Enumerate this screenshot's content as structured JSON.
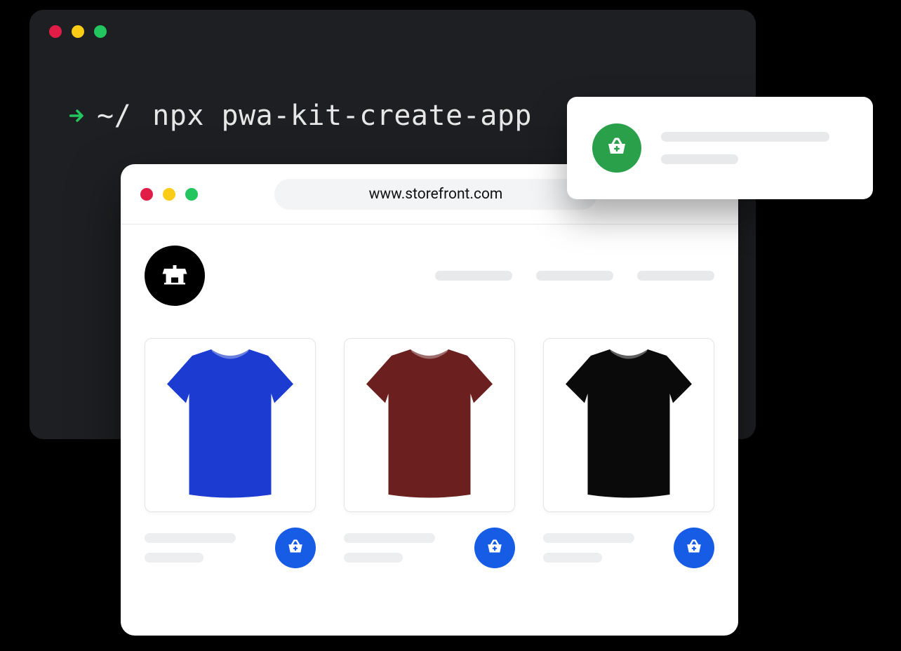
{
  "terminal": {
    "prompt": "~/",
    "command": "npx pwa-kit-create-app"
  },
  "notification": {
    "icon": "basket-plus-icon",
    "badge_color": "#2aa04a"
  },
  "browser": {
    "url": "www.storefront.com"
  },
  "store": {
    "logo_icon": "storefront-icon",
    "products": [
      {
        "icon": "tshirt",
        "color": "#1c3bd1",
        "name": "blue-tshirt"
      },
      {
        "icon": "tshirt",
        "color": "#6b1f1f",
        "name": "maroon-tshirt"
      },
      {
        "icon": "tshirt",
        "color": "#0a0a0a",
        "name": "black-tshirt"
      }
    ],
    "cart_button_color": "#175ce5"
  }
}
